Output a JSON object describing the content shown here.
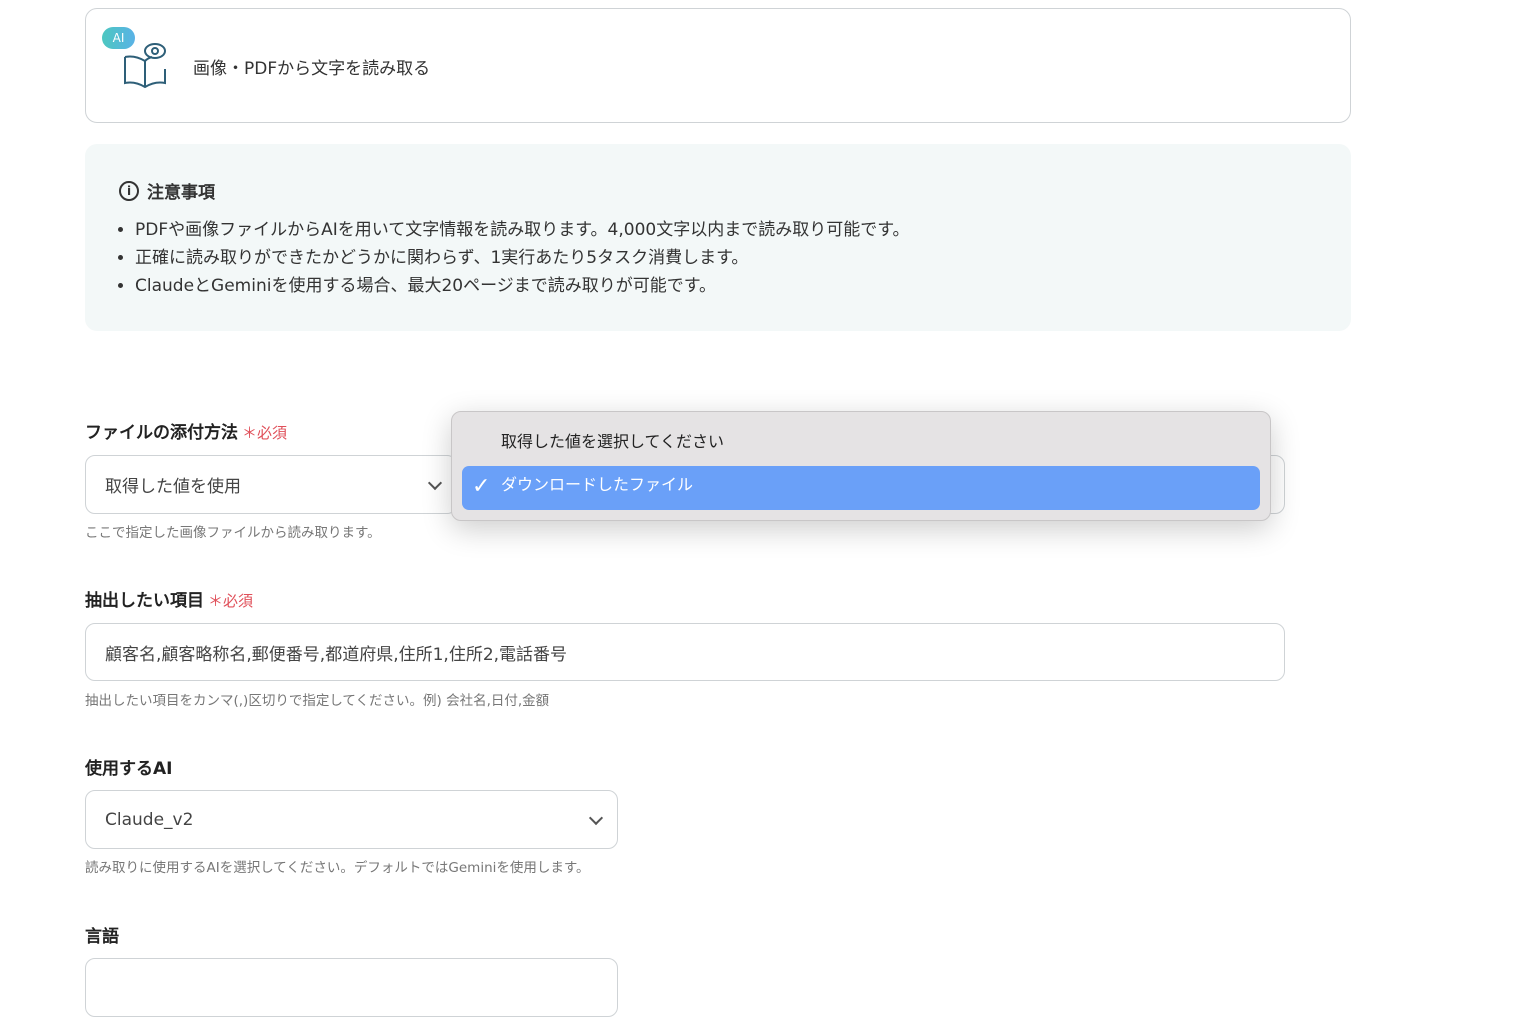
{
  "action": {
    "badge": "AI",
    "title": "画像・PDFから文字を読み取る"
  },
  "notice": {
    "title": "注意事項",
    "items": [
      "PDFや画像ファイルからAIを用いて文字情報を読み取ります。4,000文字以内まで読み取り可能です。",
      "正確に読み取りができたかどうかに関わらず、1実行あたり5タスク消費します。",
      "ClaudeとGeminiを使用する場合、最大20ページまで読み取りが可能です。"
    ]
  },
  "required": "必須",
  "file": {
    "label": "ファイルの添付方法",
    "value": "取得した値を使用",
    "help": "ここで指定した画像ファイルから読み取ります。"
  },
  "dropdown": {
    "options": [
      "取得した値を選択してください",
      "ダウンロードしたファイル"
    ],
    "selected": "ダウンロードしたファイル"
  },
  "extract": {
    "label": "抽出したい項目",
    "value": "顧客名,顧客略称名,郵便番号,都道府県,住所1,住所2,電話番号",
    "help": "抽出したい項目をカンマ(,)区切りで指定してください。例) 会社名,日付,金額"
  },
  "ai": {
    "label": "使用するAI",
    "value": "Claude_v2",
    "help": "読み取りに使用するAIを選択してください。デフォルトではGeminiを使用します。"
  },
  "lang": {
    "label": "言語"
  }
}
